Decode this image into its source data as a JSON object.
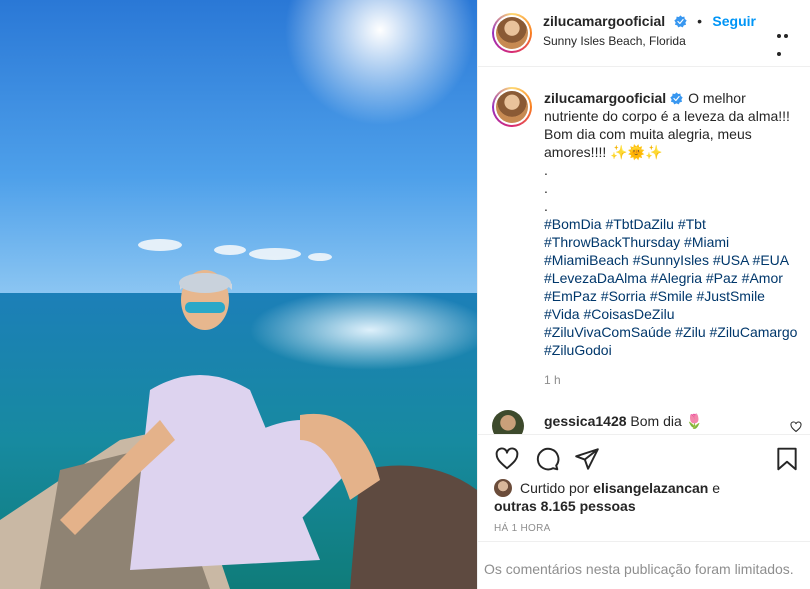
{
  "post": {
    "username": "zilucamargooficial",
    "follow_label": "Seguir",
    "separator": "•",
    "location": "Sunny Isles Beach, Florida"
  },
  "caption": {
    "username": "zilucamargooficial",
    "text": "O melhor nutriente do corpo é a leveza da alma!!! Bom dia com muita alegria, meus amores!!!! ✨🌞✨",
    "dots": [
      ".",
      ".",
      "."
    ],
    "hashtags": "#BomDia #TbtDaZilu #Tbt #ThrowBackThursday #Miami #MiamiBeach #SunnyIsles #USA #EUA #LevezaDaAlma #Alegria #Paz #Amor #EmPaz #Sorria #Smile #JustSmile #Vida #CoisasDeZilu #ZiluVivaComSaúde #Zilu #ZiluCamargo #ZiluGodoi",
    "time_ago": "1 h"
  },
  "comment": {
    "username": "gessica1428",
    "text": "Bom dia 🌷"
  },
  "likes": {
    "prefix": "Curtido por",
    "liked_user": "elisangelazancan",
    "and": "e",
    "others": "outras 8.165 pessoas"
  },
  "timestamp": "HÁ 1 HORA",
  "comments_limited": "Os comentários nesta publicação foram limitados.",
  "icons": [
    "verified-badge-icon",
    "more-options-icon",
    "heart-icon",
    "comment-icon",
    "share-icon",
    "save-bookmark-icon"
  ],
  "colors": {
    "link": "#0095f6",
    "hashtag": "#00376b",
    "muted": "#8e8e8e",
    "verified": "#3897f0"
  }
}
